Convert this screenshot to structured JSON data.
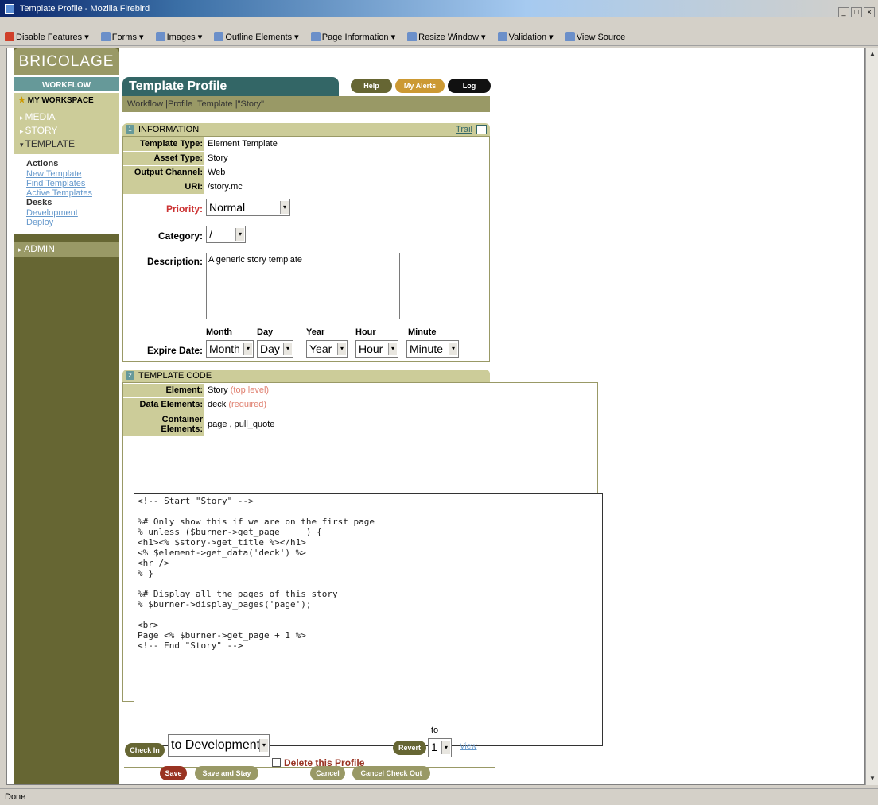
{
  "window": {
    "title": "Template Profile - Mozilla Firebird",
    "controls": [
      "_",
      "□",
      "×"
    ]
  },
  "toolbar": [
    "Disable Features",
    "Forms",
    "Images",
    "Outline Elements",
    "Page Information",
    "Resize Window",
    "Validation",
    "View Source"
  ],
  "status": "Done",
  "nav": {
    "logo": "BRICOLAGE",
    "workflow": "WORKFLOW",
    "workspace": "MY WORKSPACE",
    "media": "MEDIA",
    "story": "STORY",
    "template": "TEMPLATE",
    "actions_head": "Actions",
    "actions": [
      "New Template",
      "Find Templates",
      "Active Templates"
    ],
    "desks_head": "Desks",
    "desks": [
      "Development",
      "Deploy"
    ],
    "admin": "ADMIN"
  },
  "header": {
    "title": "Template Profile",
    "help": "Help",
    "alerts": "My Alerts",
    "logout": "Log Out",
    "breadcrumb": "Workflow |Profile |Template |\"Story\""
  },
  "info": {
    "num": "1",
    "title": "INFORMATION",
    "trail": "Trail",
    "fields": [
      {
        "label": "Template Type:",
        "value": "Element Template"
      },
      {
        "label": "Asset Type:",
        "value": "Story"
      },
      {
        "label": "Output Channel:",
        "value": "Web"
      },
      {
        "label": "URI:",
        "value": "/story.mc"
      }
    ],
    "priority_label": "Priority:",
    "priority_value": "Normal",
    "category_label": "Category:",
    "category_value": "/",
    "description_label": "Description:",
    "description_value": "A generic story template",
    "expire_label": "Expire Date:",
    "expire_heads": [
      "Month",
      "Day",
      "Year",
      "Hour",
      "Minute"
    ],
    "expire_values": [
      "Month",
      "Day",
      "Year",
      "Hour",
      "Minute"
    ]
  },
  "code": {
    "num": "2",
    "title": "TEMPLATE CODE",
    "element_label": "Element:",
    "element_value": "Story",
    "element_note": "(top level)",
    "data_label": "Data Elements:",
    "data_value": "deck",
    "data_note": "(required)",
    "container_label": "Container Elements:",
    "container_value": "page , pull_quote",
    "source": "<!-- Start \"Story\" -->\n\n%# Only show this if we are on the first page\n% unless ($burner->get_page     ) {\n<h1><% $story->get_title %></h1>\n<% $element->get_data('deck') %>\n<hr />\n% }\n\n%# Display all the pages of this story\n% $burner->display_pages('page');\n\n<br>\nPage <% $burner->get_page + 1 %>\n<!-- End \"Story\" -->"
  },
  "footer": {
    "delete_label": "Delete this Profile",
    "checkin": "Check In",
    "desk_select": "to Development",
    "revert": "Revert",
    "to_label": "to",
    "version": "1",
    "view": "View",
    "save": "Save",
    "save_stay": "Save and Stay",
    "cancel": "Cancel",
    "cancel_checkout": "Cancel Check Out"
  }
}
